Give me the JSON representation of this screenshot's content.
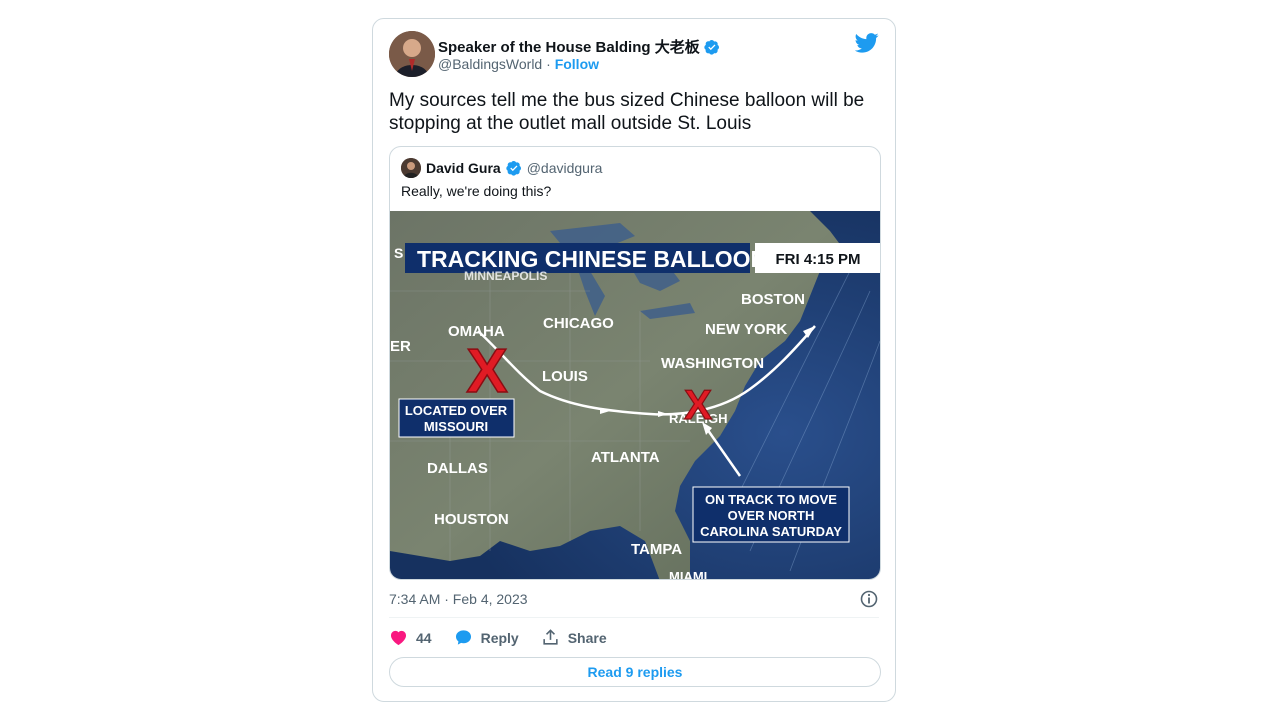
{
  "author": {
    "name": "Speaker of the House Balding 大老板",
    "handle": "@BaldingsWorld",
    "separator": "·",
    "follow_label": "Follow"
  },
  "tweet": {
    "text": "My sources tell me the bus sized Chinese balloon will be stopping at the outlet mall outside St. Louis",
    "timestamp": "7:34 AM · Feb 4, 2023"
  },
  "quote": {
    "name": "David Gura",
    "handle": "@davidgura",
    "text": "Really, we're doing this?"
  },
  "map": {
    "title": "TRACKING CHINESE BALLOON",
    "left_edge_letter": "S",
    "time": "FRI 4:15 PM",
    "cities": {
      "minneapolis": "MINNEAPOLIS",
      "boston": "BOSTON",
      "omaha": "OMAHA",
      "chicago": "CHICAGO",
      "new_york": "NEW YORK",
      "denver_partial": "ER",
      "st_louis": "LOUIS",
      "washington": "WASHINGTON",
      "raleigh": "RALEIGH",
      "atlanta": "ATLANTA",
      "dallas": "DALLAS",
      "houston": "HOUSTON",
      "tampa": "TAMPA",
      "miami": "MIAMI"
    },
    "box_missouri": [
      "LOCATED OVER",
      "MISSOURI"
    ],
    "box_carolina": [
      "ON TRACK TO MOVE",
      "OVER NORTH",
      "CAROLINA SATURDAY"
    ],
    "x_mark": "X",
    "colors": {
      "ocean": "#1e3d74",
      "land": "#6f7a66",
      "banner": "#0f2f6b",
      "x": "#e01b24"
    }
  },
  "actions": {
    "likes": "44",
    "reply_label": "Reply",
    "share_label": "Share",
    "read_replies": "Read 9 replies"
  },
  "colors": {
    "accent": "#1d9bf0",
    "heart": "#f91880"
  }
}
